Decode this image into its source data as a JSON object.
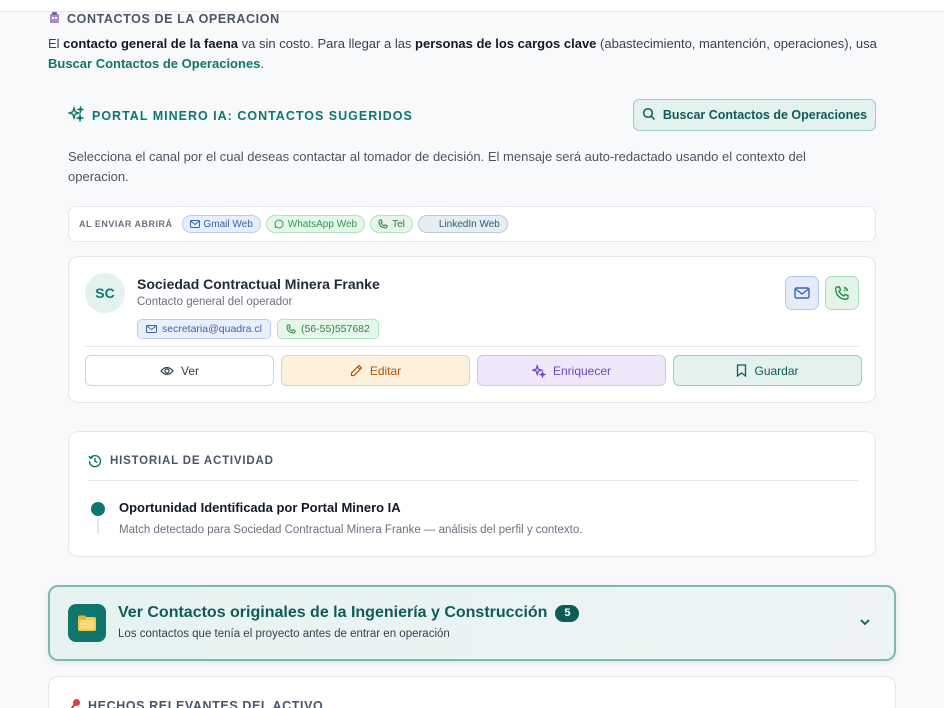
{
  "section": {
    "icon": "building-icon",
    "title": "CONTACTOS DE LA OPERACION",
    "intro_1": "El ",
    "intro_b1": "contacto general de la faena",
    "intro_2": " va sin costo. Para llegar a las ",
    "intro_b2": "personas de los cargos clave",
    "intro_3": " (abastecimiento, mantención, operaciones), usa ",
    "intro_link": "Buscar Contactos de Operaciones",
    "intro_4": "."
  },
  "portal": {
    "icon": "sparkles-icon",
    "title": "PORTAL MINERO IA: CONTACTOS SUGERIDOS",
    "search_button": "Buscar Contactos de Operaciones",
    "description": "Selecciona el canal por el cual deseas contactar al tomador de decisión. El mensaje será auto-redactado usando el contexto del operacion."
  },
  "channels": {
    "label": "AL ENVIAR ABRIRÁ",
    "items": [
      {
        "label": "Gmail Web",
        "icon": "mail-icon"
      },
      {
        "label": "WhatsApp Web",
        "icon": "whatsapp-icon"
      },
      {
        "label": "Tel",
        "icon": "phone-icon"
      },
      {
        "label": "LinkedIn Web",
        "icon": "linkedin-icon"
      }
    ]
  },
  "contact": {
    "initials": "SC",
    "name": "Sociedad Contractual Minera Franke",
    "role": "Contacto general del operador",
    "email": "secretaria@quadra.cl",
    "phone": "(56-55)557682",
    "actions": {
      "view": "Ver",
      "edit": "Editar",
      "enrich": "Enriquecer",
      "save": "Guardar"
    }
  },
  "history": {
    "title": "HISTORIAL DE ACTIVIDAD",
    "item_title": "Oportunidad Identificada por Portal Minero IA",
    "item_desc": "Match detectado para Sociedad Contractual Minera Franke — análisis del perfil y contexto."
  },
  "original_contacts": {
    "title": "Ver Contactos originales de la Ingeniería y Construcción",
    "count": "5",
    "subtitle": "Los contactos que tenía el proyecto antes de entrar en operación"
  },
  "facts": {
    "title": "HECHOS RELEVANTES DEL ACTIVO"
  },
  "colors": {
    "accent": "#0f766e",
    "gmail": "#3560b0",
    "whatsapp": "#2f9a4b",
    "edit": "#b45309",
    "enrich": "#6b46c1"
  }
}
